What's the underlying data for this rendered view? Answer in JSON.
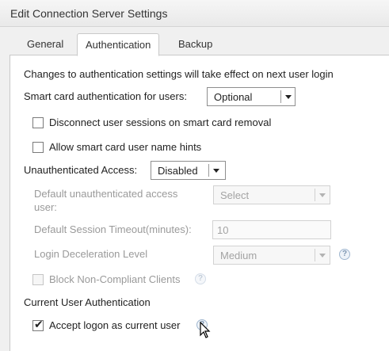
{
  "window": {
    "title": "Edit Connection Server Settings"
  },
  "tabs": [
    {
      "label": "General"
    },
    {
      "label": "Authentication"
    },
    {
      "label": "Backup"
    }
  ],
  "auth": {
    "notice": "Changes to authentication settings will take effect on next user login",
    "smartcard_label": "Smart card authentication for users:",
    "smartcard_value": "Optional",
    "disconnect_label": "Disconnect user sessions on smart card removal",
    "hints_label": "Allow smart card user name hints",
    "unauth_label": "Unauthenticated Access:",
    "unauth_value": "Disabled",
    "default_user_label_line1": "Default unauthenticated access",
    "default_user_label_line2": "user:",
    "default_user_value": "Select",
    "timeout_label": "Default Session Timeout(minutes):",
    "timeout_value": "10",
    "decel_label": "Login Deceleration Level",
    "decel_value": "Medium",
    "block_label": "Block Non-Compliant Clients",
    "current_user_heading": "Current User Authentication",
    "accept_logon_label": "Accept logon as current user"
  },
  "icons": {
    "help": "help-icon",
    "check": "checkmark-icon",
    "cursor": "mouse-pointer-icon"
  }
}
